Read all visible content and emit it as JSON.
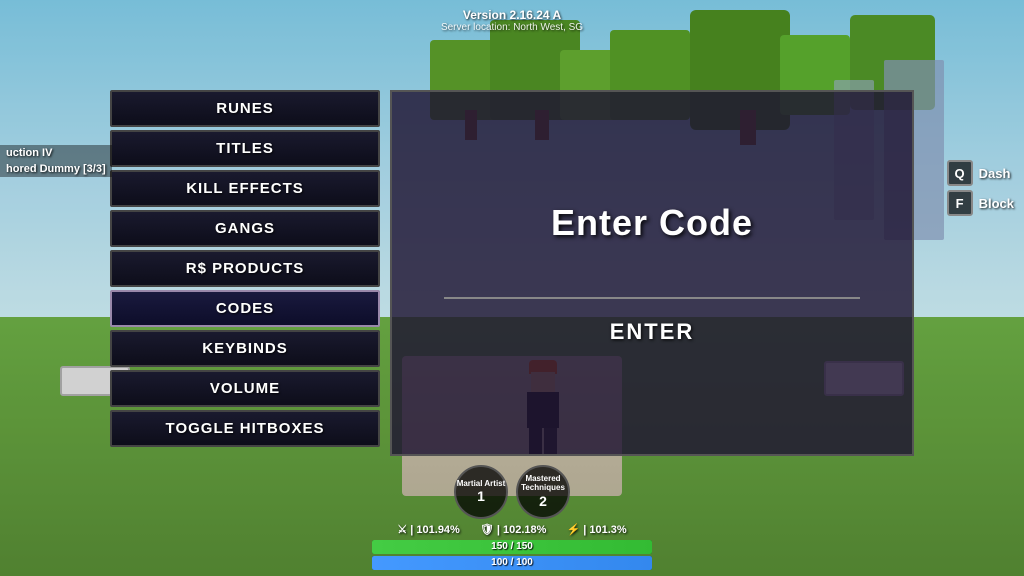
{
  "version": {
    "label": "Version 2.16.24 A",
    "server": "Server location: North West, SG"
  },
  "menu": {
    "items": [
      {
        "id": "runes",
        "label": "RUNES",
        "selected": false
      },
      {
        "id": "titles",
        "label": "TITLES",
        "selected": false
      },
      {
        "id": "kill-effects",
        "label": "KILL EFFECTS",
        "selected": false
      },
      {
        "id": "gangs",
        "label": "GANGS",
        "selected": false
      },
      {
        "id": "products",
        "label": "R$ PRODUCTS",
        "selected": false
      },
      {
        "id": "codes",
        "label": "CODES",
        "selected": true
      },
      {
        "id": "keybinds",
        "label": "KEYBINDS",
        "selected": false
      },
      {
        "id": "volume",
        "label": "VOLUME",
        "selected": false
      },
      {
        "id": "toggle-hitboxes",
        "label": "TOGGLE HITBOXES",
        "selected": false
      }
    ]
  },
  "code_panel": {
    "title": "Enter Code",
    "enter_button": "ENTER",
    "input_placeholder": ""
  },
  "keybinds": [
    {
      "key": "Q",
      "action": "Dash"
    },
    {
      "key": "F",
      "action": "Block"
    }
  ],
  "left_hud": {
    "line1": "uction IV",
    "line2": "hored Dummy [3/3]"
  },
  "bottom_hud": {
    "badges": [
      {
        "title": "Martial Artist",
        "level": "1"
      },
      {
        "title": "Mastered Techniques",
        "level": "2"
      }
    ],
    "stats": [
      {
        "icon": "⚔",
        "value": "101.94%"
      },
      {
        "icon": "🛡",
        "value": "102.18%"
      },
      {
        "icon": "⚡",
        "value": "101.3%"
      }
    ],
    "bars": [
      {
        "label": "150 / 150",
        "fill": 100,
        "type": "green"
      },
      {
        "label": "100 / 100",
        "fill": 100,
        "type": "blue"
      }
    ]
  }
}
